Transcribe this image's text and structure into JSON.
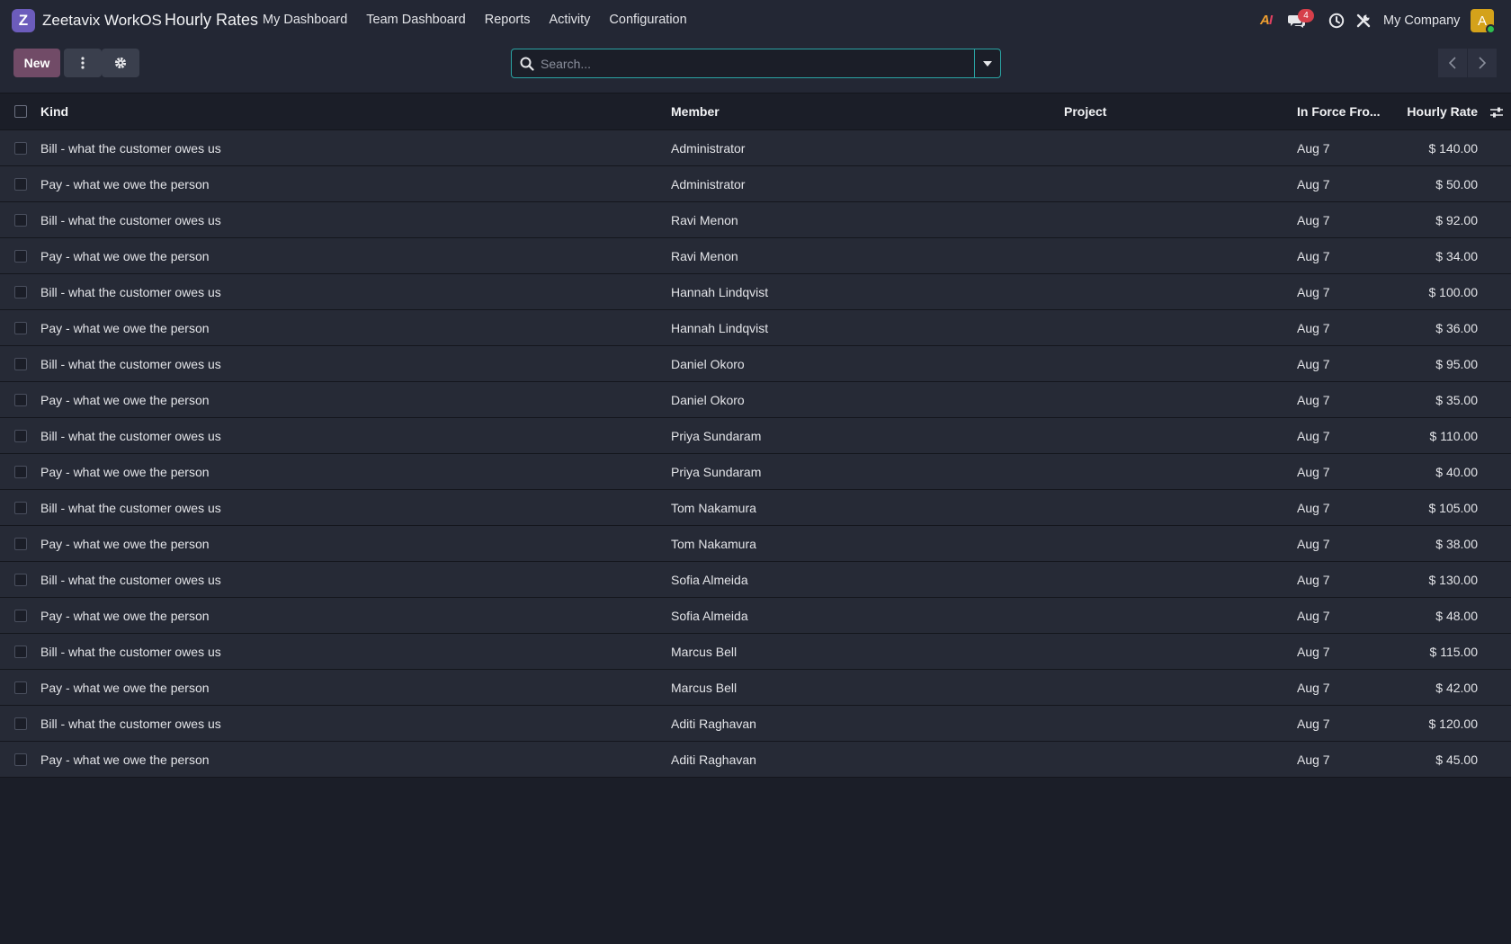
{
  "navbar": {
    "logo_letter": "Z",
    "brand": "Zeetavix WorkOS",
    "app_title": "Hourly Rates",
    "menu": [
      "My Dashboard",
      "Team Dashboard",
      "Reports",
      "Activity",
      "Configuration"
    ],
    "ai_label_a": "A",
    "ai_label_i": "I",
    "chat_badge": "4",
    "company": "My Company",
    "avatar_letter": "A"
  },
  "control": {
    "new_label": "New",
    "search_placeholder": "Search..."
  },
  "table": {
    "columns": [
      "Kind",
      "Member",
      "Project",
      "In Force Fro...",
      "Hourly Rate"
    ],
    "rows": [
      {
        "kind": "Bill - what the customer owes us",
        "member": "Administrator",
        "project": "",
        "date": "Aug 7",
        "rate": "$ 140.00"
      },
      {
        "kind": "Pay - what we owe the person",
        "member": "Administrator",
        "project": "",
        "date": "Aug 7",
        "rate": "$ 50.00"
      },
      {
        "kind": "Bill - what the customer owes us",
        "member": "Ravi Menon",
        "project": "",
        "date": "Aug 7",
        "rate": "$ 92.00"
      },
      {
        "kind": "Pay - what we owe the person",
        "member": "Ravi Menon",
        "project": "",
        "date": "Aug 7",
        "rate": "$ 34.00"
      },
      {
        "kind": "Bill - what the customer owes us",
        "member": "Hannah Lindqvist",
        "project": "",
        "date": "Aug 7",
        "rate": "$ 100.00"
      },
      {
        "kind": "Pay - what we owe the person",
        "member": "Hannah Lindqvist",
        "project": "",
        "date": "Aug 7",
        "rate": "$ 36.00"
      },
      {
        "kind": "Bill - what the customer owes us",
        "member": "Daniel Okoro",
        "project": "",
        "date": "Aug 7",
        "rate": "$ 95.00"
      },
      {
        "kind": "Pay - what we owe the person",
        "member": "Daniel Okoro",
        "project": "",
        "date": "Aug 7",
        "rate": "$ 35.00"
      },
      {
        "kind": "Bill - what the customer owes us",
        "member": "Priya Sundaram",
        "project": "",
        "date": "Aug 7",
        "rate": "$ 110.00"
      },
      {
        "kind": "Pay - what we owe the person",
        "member": "Priya Sundaram",
        "project": "",
        "date": "Aug 7",
        "rate": "$ 40.00"
      },
      {
        "kind": "Bill - what the customer owes us",
        "member": "Tom Nakamura",
        "project": "",
        "date": "Aug 7",
        "rate": "$ 105.00"
      },
      {
        "kind": "Pay - what we owe the person",
        "member": "Tom Nakamura",
        "project": "",
        "date": "Aug 7",
        "rate": "$ 38.00"
      },
      {
        "kind": "Bill - what the customer owes us",
        "member": "Sofia Almeida",
        "project": "",
        "date": "Aug 7",
        "rate": "$ 130.00"
      },
      {
        "kind": "Pay - what we owe the person",
        "member": "Sofia Almeida",
        "project": "",
        "date": "Aug 7",
        "rate": "$ 48.00"
      },
      {
        "kind": "Bill - what the customer owes us",
        "member": "Marcus Bell",
        "project": "",
        "date": "Aug 7",
        "rate": "$ 115.00"
      },
      {
        "kind": "Pay - what we owe the person",
        "member": "Marcus Bell",
        "project": "",
        "date": "Aug 7",
        "rate": "$ 42.00"
      },
      {
        "kind": "Bill - what the customer owes us",
        "member": "Aditi Raghavan",
        "project": "",
        "date": "Aug 7",
        "rate": "$ 120.00"
      },
      {
        "kind": "Pay - what we owe the person",
        "member": "Aditi Raghavan",
        "project": "",
        "date": "Aug 7",
        "rate": "$ 45.00"
      }
    ]
  },
  "colors": {
    "background": "#1b1e28",
    "navbar": "#232734",
    "row": "#262a36",
    "primary_button": "#714b67",
    "search_border": "#2aa3a3",
    "badge": "#d63f4a",
    "avatar": "#d4a21a",
    "presence": "#2fbf4f"
  },
  "icons": [
    "app-logo-icon",
    "ai-icon",
    "chat-icon",
    "clock-icon",
    "tools-icon",
    "kebab-menu-icon",
    "gear-icon",
    "search-icon",
    "caret-down-icon",
    "chevron-left-icon",
    "chevron-right-icon",
    "column-settings-icon"
  ]
}
